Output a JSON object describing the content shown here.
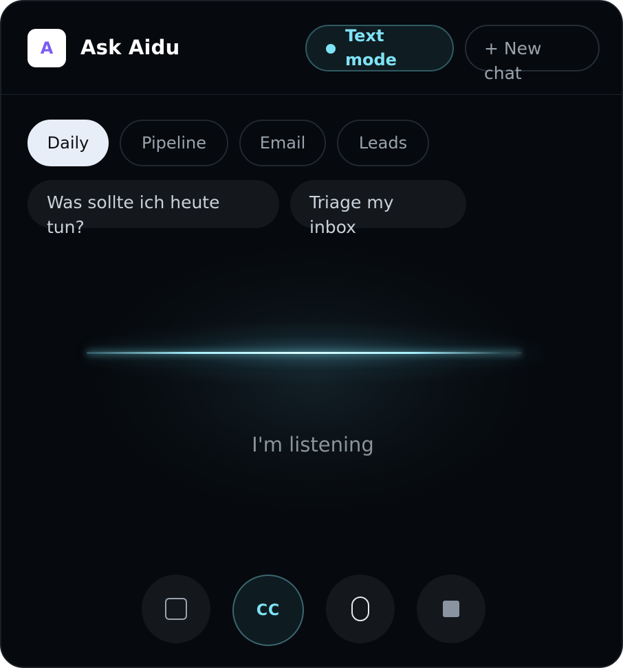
{
  "header": {
    "logo_letter": "A",
    "title": "Ask Aidu",
    "mode_button": "Text mode",
    "new_chat_button": "+ New chat"
  },
  "tabs": [
    {
      "label": "Daily",
      "active": true
    },
    {
      "label": "Pipeline",
      "active": false
    },
    {
      "label": "Email",
      "active": false
    },
    {
      "label": "Leads",
      "active": false
    }
  ],
  "suggestions": [
    "Was sollte ich heute tun?",
    "Triage my inbox"
  ],
  "status_text": "I'm listening",
  "controls": {
    "captions_label": "CC"
  },
  "colors": {
    "accent": "#7fe3f5",
    "logo_letter": "#7b5cf0",
    "background": "#06090d",
    "active_tab": "#e8eef7"
  }
}
